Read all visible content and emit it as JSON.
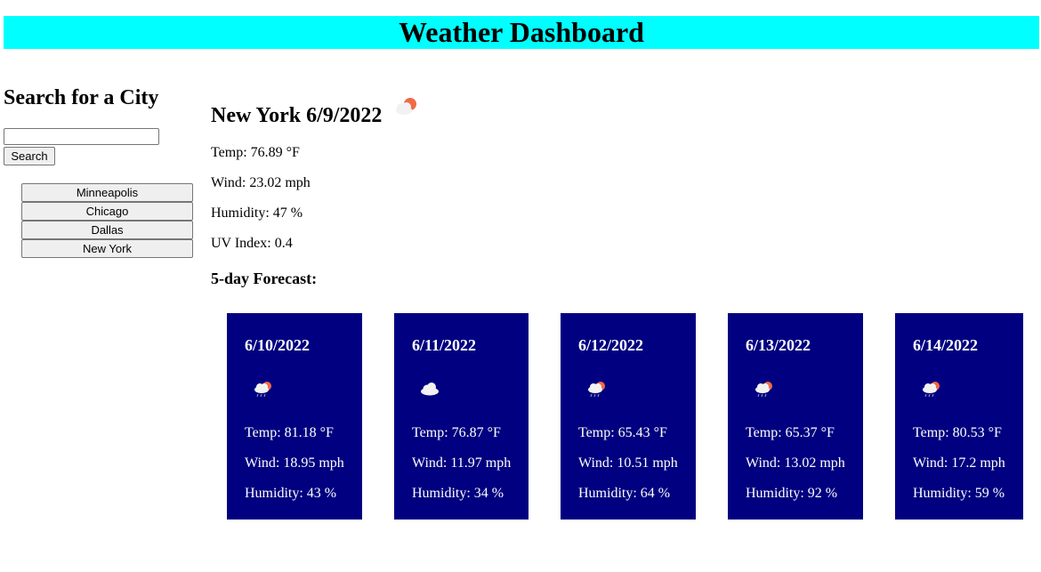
{
  "header": {
    "title": "Weather Dashboard"
  },
  "sidebar": {
    "title": "Search for a City",
    "search_value": "",
    "search_label": "Search",
    "history": [
      {
        "label": "Minneapolis"
      },
      {
        "label": "Chicago"
      },
      {
        "label": "Dallas"
      },
      {
        "label": "New York"
      }
    ]
  },
  "current": {
    "title": "New York 6/9/2022",
    "icon": "partly-cloudy-day-icon",
    "temp": "Temp: 76.89 °F",
    "wind": "Wind: 23.02 mph",
    "humidity": "Humidity: 47 %",
    "uv": "UV Index: 0.4"
  },
  "forecast": {
    "heading": "5-day Forecast:",
    "days": [
      {
        "date": "6/10/2022",
        "icon": "rain-sun-icon",
        "temp": "Temp: 81.18 °F",
        "wind": "Wind: 18.95 mph",
        "humidity": "Humidity: 43 %"
      },
      {
        "date": "6/11/2022",
        "icon": "cloud-icon",
        "temp": "Temp: 76.87 °F",
        "wind": "Wind: 11.97 mph",
        "humidity": "Humidity: 34 %"
      },
      {
        "date": "6/12/2022",
        "icon": "rain-sun-icon",
        "temp": "Temp: 65.43 °F",
        "wind": "Wind: 10.51 mph",
        "humidity": "Humidity: 64 %"
      },
      {
        "date": "6/13/2022",
        "icon": "rain-sun-icon",
        "temp": "Temp: 65.37 °F",
        "wind": "Wind: 13.02 mph",
        "humidity": "Humidity: 92 %"
      },
      {
        "date": "6/14/2022",
        "icon": "rain-sun-icon",
        "temp": "Temp: 80.53 °F",
        "wind": "Wind: 17.2 mph",
        "humidity": "Humidity: 59 %"
      }
    ]
  },
  "colors": {
    "header_bg": "#00ffff",
    "card_bg": "#000080",
    "sun": "#f06a48",
    "cloud": "#f2f2f2"
  }
}
